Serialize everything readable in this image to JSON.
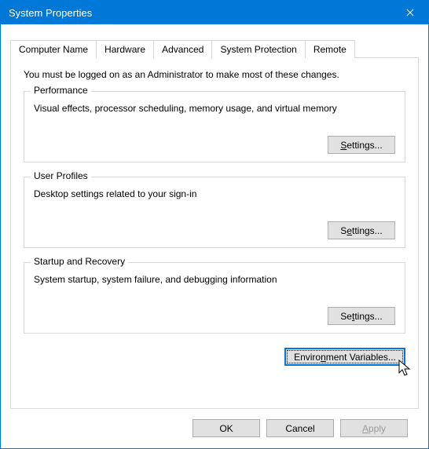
{
  "window": {
    "title": "System Properties"
  },
  "tabs": {
    "computer_name": "Computer Name",
    "hardware": "Hardware",
    "advanced": "Advanced",
    "system_protection": "System Protection",
    "remote": "Remote"
  },
  "intro": "You must be logged on as an Administrator to make most of these changes.",
  "groups": {
    "performance": {
      "title": "Performance",
      "desc": "Visual effects, processor scheduling, memory usage, and virtual memory",
      "button": "Settings..."
    },
    "user_profiles": {
      "title": "User Profiles",
      "desc": "Desktop settings related to your sign-in",
      "button": "Settings..."
    },
    "startup": {
      "title": "Startup and Recovery",
      "desc": "System startup, system failure, and debugging information",
      "button": "Settings..."
    }
  },
  "env_button": "Environment Variables...",
  "dialog": {
    "ok": "OK",
    "cancel": "Cancel",
    "apply": "Apply"
  }
}
